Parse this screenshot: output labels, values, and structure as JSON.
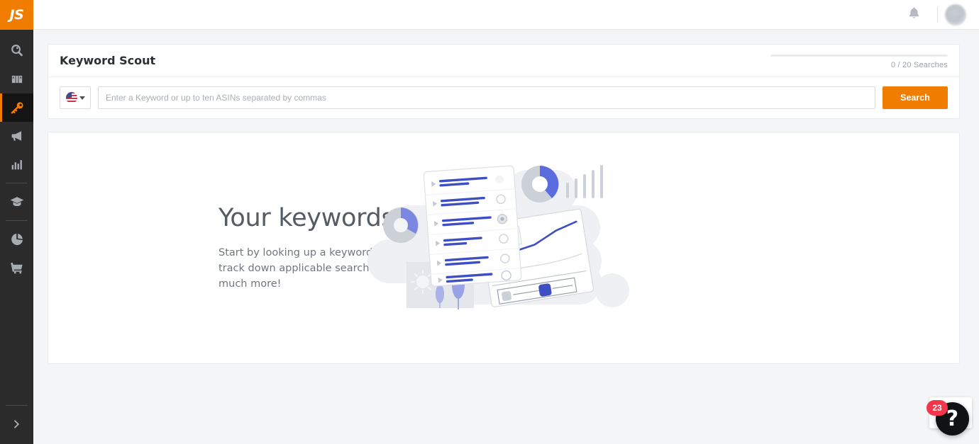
{
  "brand": {
    "logo_text": "JS",
    "accent_color": "#f07d00"
  },
  "sidebar": {
    "items": [
      {
        "name": "product-research",
        "icon": "magnifier-tag-icon",
        "active": false
      },
      {
        "name": "product-database",
        "icon": "binoculars-icon",
        "active": false
      },
      {
        "name": "keyword-scout",
        "icon": "key-icon",
        "active": true
      },
      {
        "name": "marketing",
        "icon": "megaphone-icon",
        "active": false
      },
      {
        "name": "analytics",
        "icon": "bar-chart-icon",
        "active": false
      },
      {
        "name": "academy",
        "icon": "graduation-cap-icon",
        "active": false
      },
      {
        "name": "share-of-voice",
        "icon": "pie-chart-icon",
        "active": false
      },
      {
        "name": "storefront",
        "icon": "shopping-cart-icon",
        "active": false
      }
    ],
    "expand": {
      "icon": "chevron-right-icon"
    }
  },
  "topbar": {
    "notifications_icon": "bell-icon",
    "avatar_icon": "user-avatar"
  },
  "search_panel": {
    "title": "Keyword Scout",
    "searches_used": 0,
    "searches_total": 20,
    "searches_label": "0 / 20 Searches",
    "meter_percent": 0,
    "country": {
      "flag": "us-flag-icon",
      "caret": "chevron-down-icon"
    },
    "input": {
      "value": "",
      "placeholder": "Enter a Keyword or up to ten ASINs separated by commas"
    },
    "search_button": "Search"
  },
  "empty_state": {
    "title": "Your keywords await!",
    "subtitle": "Start by looking up a keyword or Product ASIN to track down applicable search information and so much more!",
    "illustration": "keyword-research-illustration"
  },
  "help_widget": {
    "badge_count": "23",
    "glyph": "?",
    "badge_color": "#f4364c"
  }
}
